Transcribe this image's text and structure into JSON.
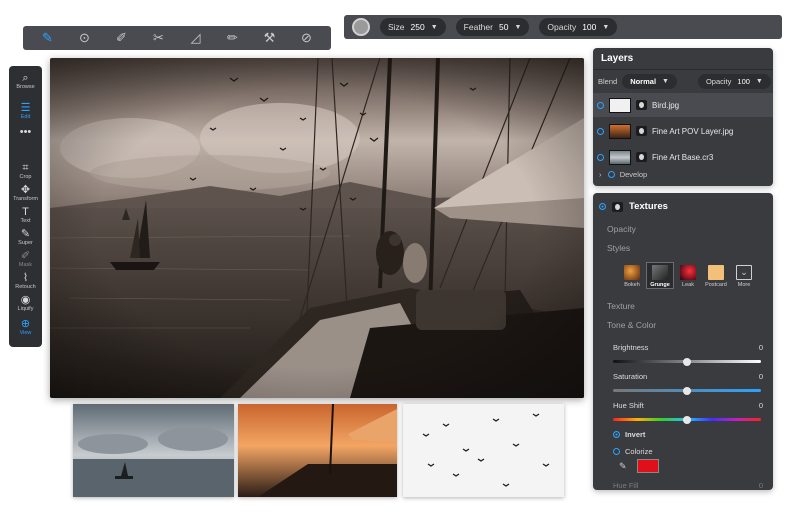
{
  "toolbar": {
    "tools": [
      {
        "name": "brush-icon",
        "glyph": "✎",
        "active": true
      },
      {
        "name": "masking-bug-icon",
        "glyph": "⊙"
      },
      {
        "name": "ai-brush-icon",
        "glyph": "✐"
      },
      {
        "name": "quick-mask-icon",
        "glyph": "✂"
      },
      {
        "name": "gradient-icon",
        "glyph": "◿"
      },
      {
        "name": "refine-brush-icon",
        "glyph": "✏"
      },
      {
        "name": "chisel-icon",
        "glyph": "⚒"
      },
      {
        "name": "blur-icon",
        "glyph": "⊘"
      }
    ]
  },
  "brush_options": {
    "size_label": "Size",
    "size_value": "250",
    "feather_label": "Feather",
    "feather_value": "50",
    "opacity_label": "Opacity",
    "opacity_value": "100"
  },
  "modules": {
    "browse": "Browse",
    "edit": "Edit",
    "crop": "Crop",
    "transform": "Transform",
    "text": "Text",
    "super": "Super",
    "mask": "Mask",
    "retouch": "Retouch",
    "liquify": "Liquify",
    "view": "View"
  },
  "layers": {
    "title": "Layers",
    "blend_label": "Blend",
    "blend_mode": "Normal",
    "opacity_label": "Opacity",
    "opacity_value": "100",
    "items": [
      {
        "name": "Bird.jpg",
        "selected": true
      },
      {
        "name": "Fine Art POV Layer.jpg",
        "selected": false
      },
      {
        "name": "Fine Art Base.cr3",
        "selected": false
      }
    ],
    "develop_label": "Develop"
  },
  "textures": {
    "title": "Textures",
    "opacity_label": "Opacity",
    "styles_label": "Styles",
    "styles": [
      {
        "label": "Bokeh",
        "color": "#7a3a1a"
      },
      {
        "label": "Grunge",
        "color": "#4b4b4b",
        "selected": true
      },
      {
        "label": "Leak",
        "color": "#b01020"
      },
      {
        "label": "Postcard",
        "color": "#f3c07a"
      },
      {
        "label": "More",
        "color": "#3a3b3f"
      }
    ],
    "texture_label": "Texture",
    "tone_color_label": "Tone & Color",
    "brightness_label": "Brightness",
    "brightness_value": "0",
    "brightness_level": 0.5,
    "saturation_label": "Saturation",
    "saturation_value": "0",
    "saturation_level": 0.5,
    "hue_shift_label": "Hue Shift",
    "hue_shift_value": "0",
    "hue_shift_level": 0.5,
    "invert_label": "Invert",
    "colorize_label": "Colorize",
    "colorize_color": "#e0101a",
    "hue_fill_label": "Hue Fill",
    "hue_fill_value": "0"
  },
  "colors": {
    "accent": "#2aa3ff",
    "panel": "#3a3b3f"
  }
}
